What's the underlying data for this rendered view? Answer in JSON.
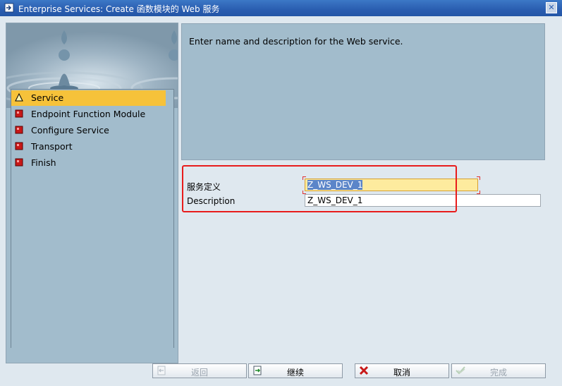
{
  "window": {
    "title": "Enterprise Services: Create 函数模块的 Web 服务",
    "close_glyph": "✕"
  },
  "steps": [
    {
      "label": "Service",
      "status": "current",
      "icon": "warning-triangle-icon"
    },
    {
      "label": "Endpoint Function Module",
      "status": "pending",
      "icon": "red-square-icon"
    },
    {
      "label": "Configure Service",
      "status": "pending",
      "icon": "red-square-icon"
    },
    {
      "label": "Transport",
      "status": "pending",
      "icon": "red-square-icon"
    },
    {
      "label": "Finish",
      "status": "pending",
      "icon": "red-square-icon"
    }
  ],
  "description_panel": {
    "text": "Enter name and description for the Web service."
  },
  "form": {
    "service_definition": {
      "label": "服务定义",
      "value": "Z_WS_DEV_1"
    },
    "description": {
      "label": "Description",
      "value": "Z_WS_DEV_1"
    }
  },
  "buttons": {
    "back": {
      "label": "返回",
      "enabled": false
    },
    "continue": {
      "label": "继续",
      "enabled": true
    },
    "cancel": {
      "label": "取消",
      "enabled": true
    },
    "complete": {
      "label": "完成",
      "enabled": false
    }
  },
  "colors": {
    "active_step": "#f6c23a",
    "panel_bg": "#a2bccc",
    "highlight_border": "#e81c1c",
    "title_bar": "#2a5db0"
  }
}
